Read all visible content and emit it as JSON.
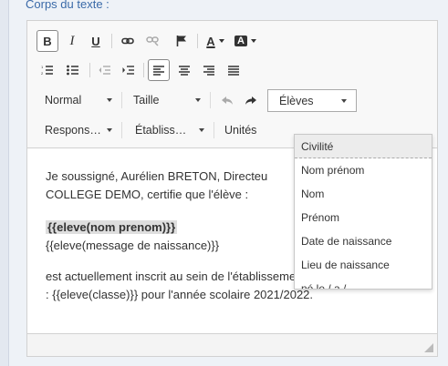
{
  "field": {
    "label": "Corps du texte :"
  },
  "toolbar": {
    "bold": "B",
    "italic": "I",
    "underline": "U",
    "text_color_label": "A",
    "bg_color_label": "A",
    "format_select": "Normal",
    "size_select": "Taille",
    "eleves_select": "Élèves",
    "responsables_select": "Respons…",
    "etablissement_select": "Établiss…",
    "unites_button": "Unités"
  },
  "dropdown": {
    "items": [
      "Civilité",
      "Nom prénom",
      "Nom",
      "Prénom",
      "Date de naissance",
      "Lieu de naissance",
      "né.le / a /"
    ]
  },
  "content": {
    "line1": "Je soussigné, Aurélien BRETON, Directeu",
    "line2": "COLLEGE DEMO, certifie que l'élève :",
    "line3": "{{eleve(nom prenom)}}",
    "line4": "{{eleve(message de naissance)}}",
    "line5": "est actuellement inscrit au sein de l'établissement en classe de",
    "line6": ": {{eleve(classe)}} pour l'année scolaire 2021/2022."
  },
  "colors": {
    "label_blue": "#3a6aa8",
    "highlight": "#dedede"
  }
}
